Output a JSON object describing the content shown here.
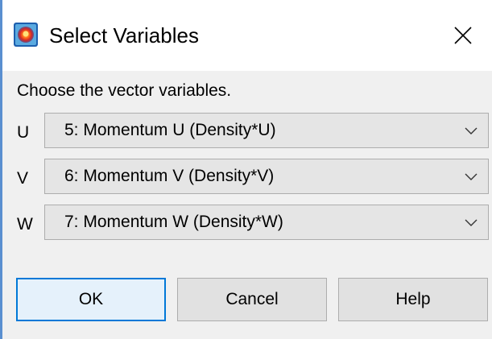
{
  "window": {
    "title": "Select Variables",
    "icon": "tecplot-app-icon",
    "close_icon": "close-icon"
  },
  "dialog": {
    "instruction": "Choose the vector variables.",
    "rows": [
      {
        "label": "U",
        "selected": "5: Momentum U (Density*U)"
      },
      {
        "label": "V",
        "selected": "6: Momentum V (Density*V)"
      },
      {
        "label": "W",
        "selected": "7: Momentum W (Density*W)"
      }
    ]
  },
  "buttons": {
    "ok": "OK",
    "cancel": "Cancel",
    "help": "Help"
  },
  "colors": {
    "accent": "#0078d7",
    "dialog_bg": "#f0f0f0",
    "titlebar_bg": "#ffffff",
    "combo_bg": "#e5e5e5",
    "button_bg": "#e1e1e1"
  }
}
